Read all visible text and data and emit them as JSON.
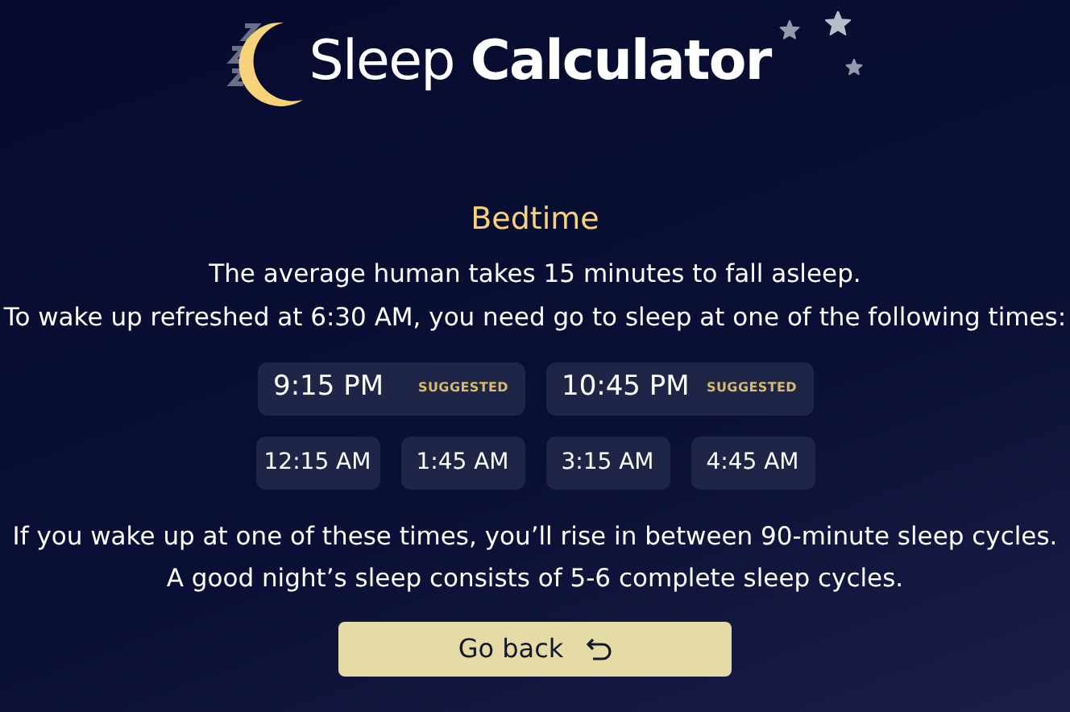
{
  "title": {
    "regular": "Sleep",
    "bold": "Calculator"
  },
  "heading": "Bedtime",
  "intro": [
    "The average human takes 15 minutes to fall asleep.",
    "To wake up refreshed at 6:30 AM, you need go to sleep at one of the following times:"
  ],
  "times": [
    {
      "time": "9:15 PM",
      "badge": "SUGGESTED"
    },
    {
      "time": "10:45 PM",
      "badge": "SUGGESTED"
    },
    {
      "time": "12:15 AM"
    },
    {
      "time": "1:45 AM"
    },
    {
      "time": "3:15 AM"
    },
    {
      "time": "4:45 AM"
    }
  ],
  "note": [
    "If you wake up at one of these times, you’ll rise in between 90-minute sleep cycles.",
    "A good night’s sleep consists of 5-6 complete sleep cycles."
  ],
  "back_button": "Go back"
}
